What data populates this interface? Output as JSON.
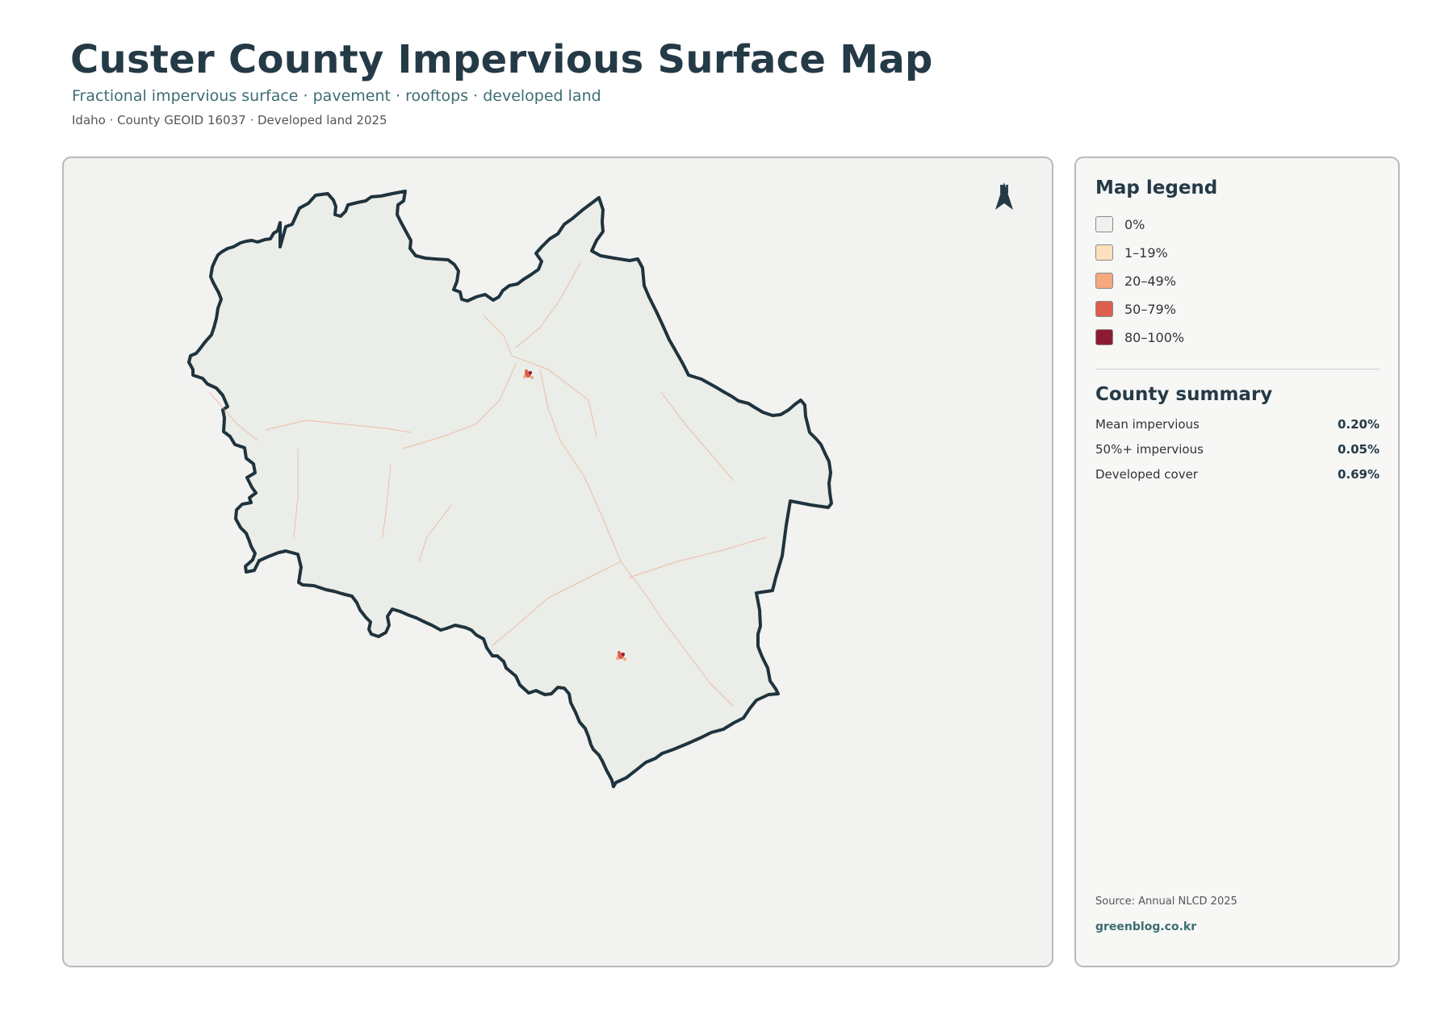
{
  "header": {
    "title": "Custer County Impervious Surface Map",
    "subtitle": "Fractional impervious surface · pavement · rooftops · developed land",
    "meta": "Idaho · County GEOID 16037 · Developed land 2025"
  },
  "map": {
    "north_label": "N",
    "county_fill": "#eaede8",
    "boundary_color": "#1f333d",
    "frame_background": "#f2f2f0"
  },
  "legend": {
    "heading": "Map legend",
    "classes": [
      {
        "label": "0%",
        "color": "#f0f0ee"
      },
      {
        "label": "1–19%",
        "color": "#fde0bd"
      },
      {
        "label": "20–49%",
        "color": "#f5a77e"
      },
      {
        "label": "50–79%",
        "color": "#dd5e4b"
      },
      {
        "label": "80–100%",
        "color": "#8c1a32"
      }
    ]
  },
  "summary": {
    "heading": "County summary",
    "stats": [
      {
        "label": "Mean impervious",
        "value": "0.20%"
      },
      {
        "label": "50%+ impervious",
        "value": "0.05%"
      },
      {
        "label": "Developed cover",
        "value": "0.69%"
      }
    ]
  },
  "footer": {
    "source": "Source: Annual NLCD 2025",
    "credit": "greenblog.co.kr"
  }
}
